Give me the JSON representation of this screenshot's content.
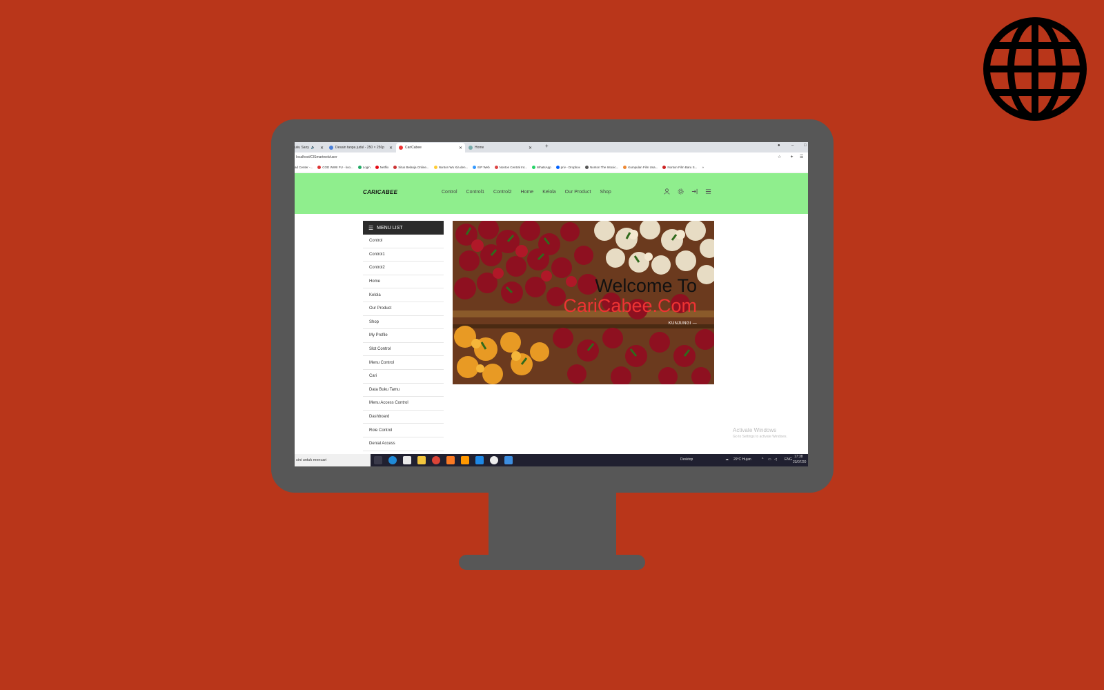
{
  "browser": {
    "tabs": [
      {
        "label": "uku Sany",
        "active": false
      },
      {
        "label": "Desain tanpa judul - 250 × 250p",
        "active": false
      },
      {
        "label": "CariCabee",
        "active": true
      },
      {
        "label": "Home",
        "active": false
      }
    ],
    "new_tab": "+",
    "url": "localhost/CISmartweb/user",
    "bookmarks": [
      "ad Center -...",
      "COD WWII FU - koo...",
      "Login",
      "Netflix",
      "Situs Belanja Online...",
      "Nonton Wu Xia den...",
      "EiP Web",
      "Nonton Central Int...",
      "WhatsApp",
      "priv - Dropbox",
      "Nonton The Intoxic...",
      "Kumpulan Film Usa...",
      "Nonton Film Baru S..."
    ],
    "bookmarks_more": "»"
  },
  "site": {
    "logo": "CARICABEE",
    "nav": [
      "Control",
      "Control1",
      "Control2",
      "Home",
      "Kelola",
      "Our Product",
      "Shop"
    ],
    "header_icons": [
      "user-icon",
      "gear-icon",
      "logout-icon",
      "hamburger-icon"
    ]
  },
  "sidebar": {
    "title": "MENU LIST",
    "items": [
      "Control",
      "Control1",
      "Control2",
      "Home",
      "Kelola",
      "Our Product",
      "Shop",
      "My Profile",
      "Slot Control",
      "Menu Control",
      "Cari",
      "Data Buku Tamu",
      "Menu Access Control",
      "Dashboard",
      "Role Control",
      "Denial Access"
    ]
  },
  "hero": {
    "title": "Welcome To",
    "subtitle": "CariCabee.Com",
    "link": "KUNJUNGI"
  },
  "watermark": {
    "line1": "Activate Windows",
    "line2": "Go to Settings to activate Windows."
  },
  "taskbar": {
    "search": "sini untuk mencari",
    "desktop": "Desktop",
    "weather": "29°C  Hujan",
    "lang": "ENG",
    "time": "17:38",
    "date": "23/07/20"
  },
  "colors": {
    "background": "#b9361a",
    "monitor": "#575757",
    "header_green": "#8fee8d",
    "sidebar_head": "#2b2b2b",
    "hero_accent": "#ee3333"
  }
}
